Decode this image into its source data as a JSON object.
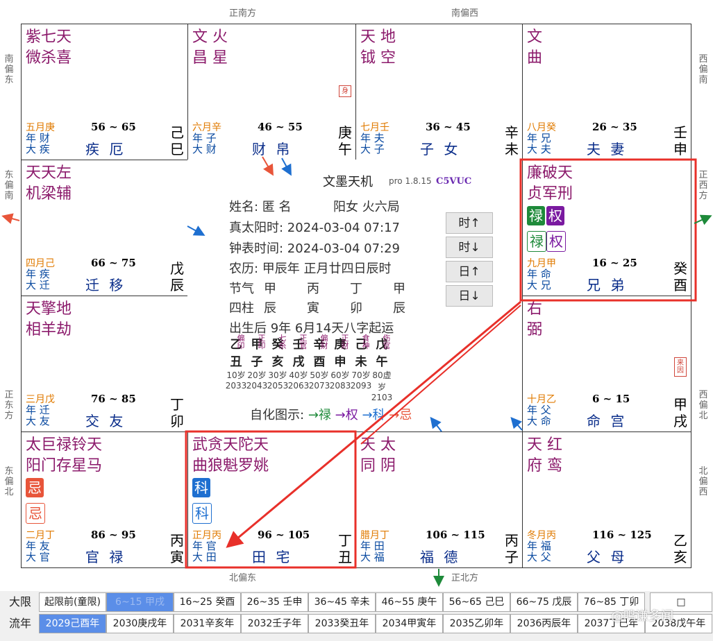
{
  "directions": {
    "top1": "正南方",
    "top2": "南偏西",
    "bottom1": "北偏东",
    "bottom2": "正北方",
    "left1": "南偏东",
    "left2": "东偏南",
    "left3": "正东方",
    "left4": "东偏北",
    "right1": "西偏南",
    "right2": "正西方",
    "right3": "西偏北",
    "right4": "北偏西"
  },
  "palaces": [
    {
      "id": "p-si",
      "stars": [
        "紫七天",
        "微杀喜"
      ],
      "month": "五月庚",
      "age": "56 ~ 65",
      "sub1": "年 财",
      "sub2": "大 疾",
      "name": "疾 厄",
      "gz": [
        "己",
        "巳"
      ]
    },
    {
      "id": "p-wu",
      "stars": [
        "文 火",
        "昌 星"
      ],
      "month": "六月辛",
      "age": "46 ~ 55",
      "sub1": "年 子",
      "sub2": "大 财",
      "name": "财 帛",
      "gz": [
        "庚",
        "午"
      ],
      "mark": "身"
    },
    {
      "id": "p-wei",
      "stars": [
        "天 地",
        "钺 空"
      ],
      "month": "七月壬",
      "age": "36 ~ 45",
      "sub1": "年 夫",
      "sub2": "大 子",
      "name": "子 女",
      "gz": [
        "辛",
        "未"
      ]
    },
    {
      "id": "p-shen",
      "stars": [
        "文",
        "曲"
      ],
      "month": "八月癸",
      "age": "26 ~ 35",
      "sub1": "年 兄",
      "sub2": "大 夫",
      "name": "夫 妻",
      "gz": [
        "壬",
        "申"
      ]
    },
    {
      "id": "p-chen",
      "stars": [
        "天天左",
        "机梁辅"
      ],
      "month": "四月己",
      "age": "66 ~ 75",
      "sub1": "年 疾",
      "sub2": "大 迁",
      "name": "迁 移",
      "gz": [
        "戊",
        "辰"
      ]
    },
    {
      "id": "p-you",
      "stars": [
        "廉破天",
        "贞军刑"
      ],
      "month": "九月甲",
      "age": "16 ~ 25",
      "sub1": "年 命",
      "sub2": "大 兄",
      "name": "兄 弟",
      "gz": [
        "癸",
        "酉"
      ],
      "badge1": [
        "禄",
        "权"
      ],
      "badge2": [
        "禄",
        "权"
      ]
    },
    {
      "id": "p-mao",
      "stars": [
        "天擎地",
        "相羊劫"
      ],
      "month": "三月戊",
      "age": "76 ~ 85",
      "sub1": "年 迁",
      "sub2": "大 友",
      "name": "交 友",
      "gz": [
        "丁",
        "卯"
      ]
    },
    {
      "id": "p-xu",
      "stars": [
        "右",
        "弼"
      ],
      "month": "十月乙",
      "age": "6 ~ 15",
      "sub1": "年 父",
      "sub2": "大 命",
      "name": "命 宫",
      "gz": [
        "甲",
        "戌"
      ],
      "mark": "来因"
    },
    {
      "id": "p-yin",
      "stars": [
        "太巨禄铃天",
        "阳门存星马"
      ],
      "month": "二月丁",
      "age": "86 ~ 95",
      "sub1": "年 友",
      "sub2": "大 官",
      "name": "官 禄",
      "gz": [
        "丙",
        "寅"
      ],
      "badge1": [
        "忌"
      ],
      "badge2": [
        "忌"
      ]
    },
    {
      "id": "p-chou",
      "stars": [
        "武贪天陀天",
        "曲狼魁罗姚"
      ],
      "month": "正月丙",
      "age": "96 ~ 105",
      "sub1": "年 官",
      "sub2": "大 田",
      "name": "田 宅",
      "gz": [
        "丁",
        "丑"
      ],
      "badge1": [
        "科"
      ],
      "badge2": [
        "科"
      ]
    },
    {
      "id": "p-zi",
      "stars": [
        "天 太",
        "同 阴"
      ],
      "month": "腊月丁",
      "age": "106 ~ 115",
      "sub1": "年 田",
      "sub2": "大 福",
      "name": "福 德",
      "gz": [
        "丙",
        "子"
      ]
    },
    {
      "id": "p-hai",
      "stars": [
        "天 红",
        "府 鸾"
      ],
      "month": "冬月丙",
      "age": "116 ~ 125",
      "sub1": "年 福",
      "sub2": "大 父",
      "name": "父 母",
      "gz": [
        "乙",
        "亥"
      ]
    }
  ],
  "center": {
    "title": "文墨天机",
    "version": "pro 1.8.15",
    "code": "C5VUC",
    "name_line": "姓名: 匿 名",
    "gender_line": "阳女 火六局",
    "solar_time": "真太阳时: 2024-03-04 07:17",
    "clock_time": "钟表时间: 2024-03-04 07:29",
    "lunar": "农历: 甲辰年 正月廿四日辰时",
    "jieqi_label": "节气",
    "sizhu_label": "四柱",
    "jieqi": [
      "甲",
      "丙",
      "丁",
      "甲"
    ],
    "sizhu": [
      "辰",
      "寅",
      "卯",
      "辰"
    ],
    "qiyun": "出生后 9年 6月14天八字起运",
    "dayun": [
      {
        "g": "乙",
        "z": "丑",
        "ss": "偏印",
        "age": "10岁",
        "yr": "2033"
      },
      {
        "g": "甲",
        "z": "子",
        "ss": "正印",
        "age": "20岁",
        "yr": "2043"
      },
      {
        "g": "癸",
        "z": "亥",
        "ss": "七杀",
        "age": "30岁",
        "yr": "2053"
      },
      {
        "g": "壬",
        "z": "戌",
        "ss": "正官",
        "age": "40岁",
        "yr": "2063"
      },
      {
        "g": "辛",
        "z": "酉",
        "ss": "偏财",
        "age": "50岁",
        "yr": "2073"
      },
      {
        "g": "庚",
        "z": "申",
        "ss": "正财",
        "age": "60岁",
        "yr": "2083"
      },
      {
        "g": "己",
        "z": "未",
        "ss": "食神",
        "age": "70岁",
        "yr": "2093"
      },
      {
        "g": "戊",
        "z": "午",
        "ss": "伤官",
        "age": "80虚岁",
        "yr": "2103"
      }
    ],
    "legend_label": "自化图示:",
    "legend_lu": "→禄",
    "legend_quan": "→权",
    "legend_ke": "→科",
    "legend_ji": "→忌",
    "buttons": [
      "时↑",
      "时↓",
      "日↑",
      "日↓"
    ]
  },
  "colors": {
    "lu": "#1e8a3a",
    "quan": "#7a1aa0",
    "ke": "#1e6fd0",
    "ji": "#e8553a",
    "highlight": "#e8302a"
  },
  "bottom": {
    "daxian_label": "大限",
    "liunian_label": "流年",
    "daxian": [
      "起限前(童限)",
      "6~15 甲戌",
      "16~25 癸酉",
      "26~35 壬申",
      "36~45 辛未",
      "46~55 庚午",
      "56~65 己巳",
      "66~75 戊辰",
      "76~85 丁卯"
    ],
    "liunian": [
      "2029己酉年",
      "2030庚戌年",
      "2031辛亥年",
      "2032壬子年",
      "2033癸丑年",
      "2034甲寅年",
      "2035乙卯年",
      "2036丙辰年",
      "2037丁巳年",
      "2038戊午年"
    ],
    "watermark": "@鸣谦多闻"
  }
}
